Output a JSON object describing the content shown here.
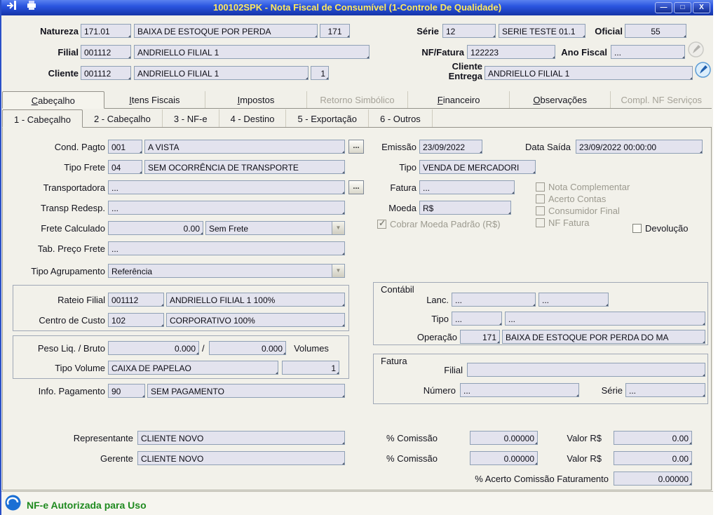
{
  "titlebar": {
    "title": "100102SPK - Nota Fiscal de Consumível (1-Controle De Qualidade)",
    "minimize_glyph": "—",
    "maximize_glyph": "□",
    "close_glyph": "X"
  },
  "icons": {
    "dropdown_arrow": "▼",
    "check_mark": "✓"
  },
  "header": {
    "natureza_label": "Natureza",
    "natureza_code": "171.01",
    "natureza_desc": "BAIXA DE ESTOQUE POR PERDA",
    "natureza_extra": "171",
    "serie_label": "Série",
    "serie_code": "12",
    "serie_desc": "SERIE TESTE 01.1",
    "oficial_label": "Oficial",
    "oficial_value": "55",
    "filial_label": "Filial",
    "filial_code": "001112",
    "filial_desc": "ANDRIELLO FILIAL 1",
    "nf_label": "NF/Fatura",
    "nf_value": "122223",
    "ano_label": "Ano Fiscal",
    "ano_value": "...",
    "cliente_label": "Cliente",
    "cliente_code": "001112",
    "cliente_desc": "ANDRIELLO FILIAL 1",
    "cliente_loja": "1",
    "entrega_label": "Cliente Entrega",
    "entrega_value": "ANDRIELLO FILIAL 1"
  },
  "tabs": [
    {
      "label": "Cabeçalho"
    },
    {
      "label": "Itens Fiscais"
    },
    {
      "label": "Impostos"
    },
    {
      "label": "Retorno Simbólico"
    },
    {
      "label": "Financeiro"
    },
    {
      "label": "Observações"
    },
    {
      "label": "Compl. NF Serviços"
    }
  ],
  "subtabs": [
    {
      "label": "1 - Cabeçalho"
    },
    {
      "label": "2 - Cabeçalho"
    },
    {
      "label": "3 - NF-e"
    },
    {
      "label": "4 - Destino"
    },
    {
      "label": "5 - Exportação"
    },
    {
      "label": "6 - Outros"
    }
  ],
  "form": {
    "lookup_label": "...",
    "cond_pagto_label": "Cond. Pagto",
    "cond_pagto_code": "001",
    "cond_pagto_desc": "A VISTA",
    "tipo_frete_label": "Tipo Frete",
    "tipo_frete_code": "04",
    "tipo_frete_desc": "SEM OCORRÊNCIA DE TRANSPORTE",
    "transportadora_label": "Transportadora",
    "transportadora_value": "...",
    "transp_redesp_label": "Transp Redesp.",
    "transp_redesp_value": "...",
    "frete_calculado_label": "Frete Calculado",
    "frete_calculado_value": "0.00",
    "frete_tipo_value": "Sem Frete",
    "tab_preco_frete_label": "Tab. Preço Frete",
    "tab_preco_frete_value": "...",
    "tipo_agrupamento_label": "Tipo Agrupamento",
    "tipo_agrupamento_value": "Referência",
    "rateio_filial_label": "Rateio Filial",
    "rateio_filial_code": "001112",
    "rateio_filial_desc": "ANDRIELLO FILIAL 1 100%",
    "centro_custo_label": "Centro de Custo",
    "centro_custo_code": "102",
    "centro_custo_desc": "CORPORATIVO 100%",
    "peso_label": "Peso Liq. / Bruto",
    "peso_liq_value": "0.000",
    "peso_sep": "/",
    "peso_bruto_value": "0.000",
    "volumes_label": "Volumes",
    "tipo_volume_label": "Tipo Volume",
    "tipo_volume_value": "CAIXA DE PAPELAO",
    "volume_qty_value": "1",
    "info_pagamento_label": "Info. Pagamento",
    "info_pagamento_code": "90",
    "info_pagamento_desc": "SEM PAGAMENTO",
    "emissao_label": "Emissão",
    "emissao_value": "23/09/2022",
    "data_saida_label": "Data Saída",
    "data_saida_value": "23/09/2022 00:00:00",
    "tipo_label": "Tipo",
    "tipo_value": "VENDA DE MERCADORI",
    "fatura_label": "Fatura",
    "fatura_value": "...",
    "moeda_label": "Moeda",
    "moeda_value": "R$",
    "cb_nota_complementar": "Nota Complementar",
    "cb_acerto_contas": "Acerto Contas",
    "cb_consumidor_final": "Consumidor Final",
    "cb_nf_fatura": "NF Fatura",
    "cb_devolucao": "Devolução",
    "cb_cobrar_moeda": "Cobrar Moeda Padrão (R$)"
  },
  "contabil": {
    "title": "Contábil",
    "lanc_label": "Lanc.",
    "lanc_value1": "...",
    "lanc_value2": "...",
    "tipo_label": "Tipo",
    "tipo_value1": "...",
    "tipo_value2": "...",
    "operacao_label": "Operação",
    "operacao_code": "171",
    "operacao_desc": "BAIXA DE ESTOQUE POR PERDA DO MA"
  },
  "fatura_box": {
    "title": "Fatura",
    "filial_label": "Filial",
    "filial_value": "",
    "numero_label": "Número",
    "numero_value": "...",
    "serie_label": "Série",
    "serie_value": "..."
  },
  "commission": {
    "representante_label": "Representante",
    "representante_value": "CLIENTE NOVO",
    "gerente_label": "Gerente",
    "gerente_value": "CLIENTE NOVO",
    "pct_label": "% Comissão",
    "pct1_value": "0.00000",
    "pct2_value": "0.00000",
    "valor_label": "Valor R$",
    "valor1_value": "0.00",
    "valor2_value": "0.00",
    "acerto_label": "% Acerto Comissão Faturamento",
    "acerto_value": "0.00000"
  },
  "statusbar": {
    "message": "NF-e Autorizada para Uso"
  }
}
